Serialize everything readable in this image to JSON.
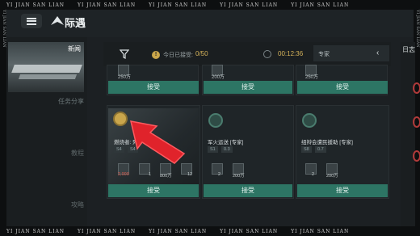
{
  "watermark": {
    "text": "YI JIAN SAN LIAN",
    "side_text": "YI JIAN SAN LIAN"
  },
  "header": {
    "title": "际遇",
    "menu_icon": "menu-icon",
    "logo_icon": "compass-logo-icon"
  },
  "sidebar": {
    "banner_label": "新闻",
    "items": [
      {
        "label": "任务分享"
      },
      {
        "label": "教程"
      },
      {
        "label": "攻略"
      }
    ]
  },
  "filter": {
    "info_icon": "!",
    "accepted_label": "今日已接受:",
    "accepted_count": "0/50",
    "timer": "00:12:36",
    "difficulty": "专家",
    "chevron": "‹"
  },
  "cards_top": [
    {
      "reward": "250万",
      "accept_label": "接受"
    },
    {
      "reward": "200万",
      "accept_label": "接受"
    },
    {
      "reward": "250万",
      "accept_label": "接受"
    }
  ],
  "cards": [
    {
      "title": "燃烧者: 死",
      "tags": [
        "S4",
        "S4"
      ],
      "rewards": [
        {
          "value": "2,000",
          "color": "#e25a4c"
        },
        {
          "value": "1"
        },
        {
          "value": "800万"
        },
        {
          "value": "12"
        }
      ],
      "accept_label": "接受"
    },
    {
      "title": "军火运送 [专家]",
      "tags": [
        "S1",
        "0.3"
      ],
      "rewards": [
        {
          "value": "2"
        },
        {
          "value": "200万"
        }
      ],
      "accept_label": "接受"
    },
    {
      "title": "组辩会遭民援助 [专家]",
      "tags": [
        "S8",
        "0.7"
      ],
      "rewards": [
        {
          "value": "2"
        },
        {
          "value": "200万"
        }
      ],
      "accept_label": "接受"
    }
  ],
  "right_panel": {
    "title": "日志"
  },
  "colors": {
    "accent": "#2d7564",
    "gold": "#d6b35a",
    "pointer": "#e0232b"
  }
}
